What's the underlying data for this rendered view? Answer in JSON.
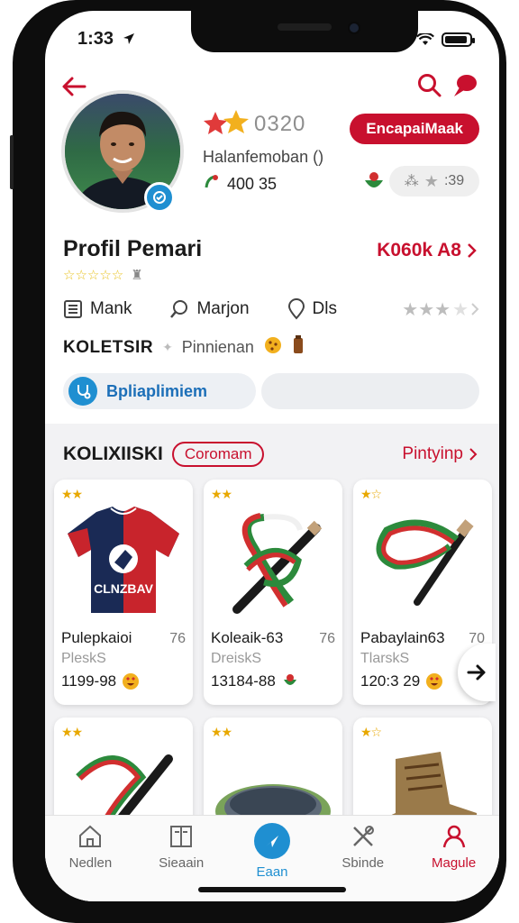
{
  "status_bar": {
    "time": "1:33"
  },
  "profile": {
    "score": "0320",
    "handle": "Halanfemoban ()",
    "coins": "400 35",
    "action_button": "EncapaiMaak",
    "rating_text": ":39",
    "title": "Profil Pemari",
    "link": "K060k A8"
  },
  "meta": {
    "items": [
      {
        "label": "Mank"
      },
      {
        "label": "Marjon"
      },
      {
        "label": "Dls"
      }
    ]
  },
  "koleksi": {
    "label": "KOLETSIR",
    "sub": "Pinnienan"
  },
  "pill_left": "Bpliaplimiem",
  "section": {
    "title": "KOLIXIISKI",
    "tag": "Coromam",
    "more": "Pintyinp"
  },
  "cards": [
    {
      "name": "Pulepkaioi",
      "num": "76",
      "type": "PleskS",
      "price": "1199-98",
      "image": "jersey",
      "stars": "★★"
    },
    {
      "name": "Koleaik-63",
      "num": "76",
      "type": "DreiskS",
      "price": "13184-88",
      "image": "scarf-stick",
      "stars": "★★"
    },
    {
      "name": "Pabaylain63",
      "num": "70",
      "type": "TlarskS",
      "price": "120:3 29",
      "image": "stick",
      "stars": "★☆"
    },
    {
      "name": "",
      "num": "",
      "type": "",
      "price": "",
      "image": "scarf",
      "stars": "★★"
    },
    {
      "name": "",
      "num": "",
      "type": "",
      "price": "",
      "image": "bowl",
      "stars": "★★"
    },
    {
      "name": "",
      "num": "",
      "type": "",
      "price": "",
      "image": "boot",
      "stars": "★☆"
    }
  ],
  "jersey_text": "CLNZBAV",
  "tabs": [
    {
      "label": "Nedlen",
      "icon": "home-icon"
    },
    {
      "label": "Sieaain",
      "icon": "book-icon"
    },
    {
      "label": "Eaan",
      "icon": "send-icon"
    },
    {
      "label": "Sbinde",
      "icon": "tools-icon"
    },
    {
      "label": "Magule",
      "icon": "profile-icon"
    }
  ],
  "colors": {
    "accent_red": "#c8102e",
    "accent_blue": "#1f8fd1"
  }
}
